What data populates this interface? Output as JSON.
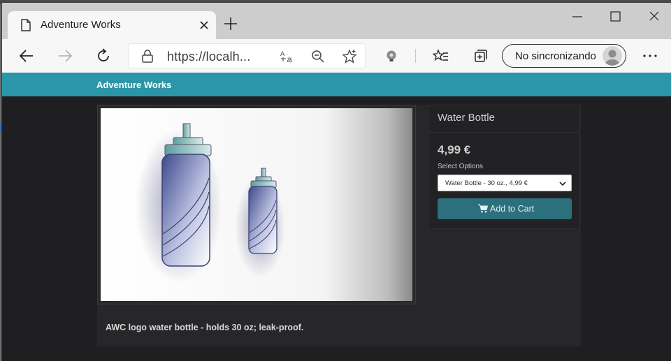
{
  "browser": {
    "tab_title": "Adventure Works",
    "url": "https://localh...",
    "sync_label": "No sincronizando",
    "colors": {
      "tabbar": "#cdcdcd",
      "toolbar": "#f7f7f7"
    },
    "icons": {
      "tab": "page-icon",
      "close": "close-icon",
      "new_tab": "plus-icon",
      "back": "back-arrow-icon",
      "forward": "forward-arrow-icon",
      "refresh": "refresh-icon",
      "lock": "lock-icon",
      "translate": "translate-icon",
      "zoom": "zoom-out-icon",
      "favorite": "star-icon",
      "extension": "lightbulb-icon",
      "favorites_bar": "favorites-icon",
      "collections": "collections-icon",
      "more": "more-icon"
    }
  },
  "site": {
    "brand": "Adventure Works",
    "accent_color": "#2b96a7"
  },
  "product": {
    "name": "Water Bottle",
    "price": "4,99 €",
    "options_label": "Select Options",
    "selected_option": "Water Bottle - 30 oz., 4,99 €",
    "add_to_cart_label": "Add to Cart",
    "description": "AWC logo water bottle - holds 30 oz; leak-proof.",
    "button_color": "#2c6f7d"
  }
}
